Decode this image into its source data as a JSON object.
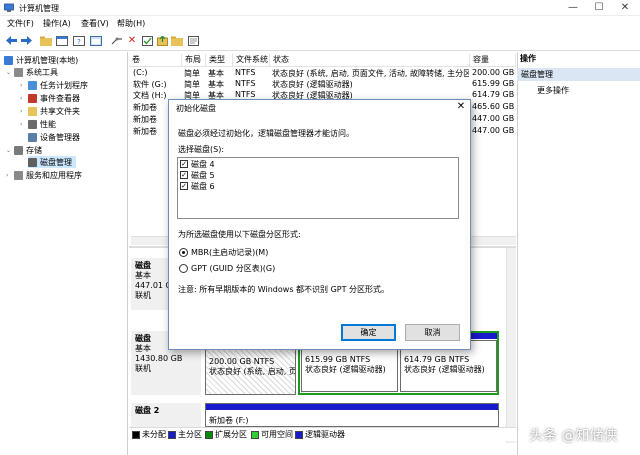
{
  "window": {
    "title": "计算机管理",
    "controls": [
      "—",
      "☐",
      "✕"
    ]
  },
  "menu": [
    "文件(F)",
    "操作(A)",
    "查看(V)",
    "帮助(H)"
  ],
  "toolbar": [
    "back-arrow-icon",
    "forward-arrow-icon",
    "folder-up-icon",
    "properties-icon",
    "help-icon",
    "console-icon",
    "connect-icon",
    "delete-icon",
    "check-icon",
    "export-icon",
    "folder-icon",
    "properties-sheet-icon"
  ],
  "tree": {
    "root": "计算机管理(本地)",
    "items": [
      {
        "label": "系统工具",
        "level": 1,
        "expanded": true,
        "selected": false
      },
      {
        "label": "任务计划程序",
        "level": 2,
        "expanded": false,
        "selected": false
      },
      {
        "label": "事件查看器",
        "level": 2,
        "expanded": false,
        "selected": false
      },
      {
        "label": "共享文件夹",
        "level": 2,
        "expanded": false,
        "selected": false
      },
      {
        "label": "性能",
        "level": 2,
        "expanded": false,
        "selected": false
      },
      {
        "label": "设备管理器",
        "level": 2,
        "expanded": false,
        "selected": false
      },
      {
        "label": "存储",
        "level": 1,
        "expanded": true,
        "selected": false
      },
      {
        "label": "磁盘管理",
        "level": 2,
        "expanded": false,
        "selected": true
      },
      {
        "label": "服务和应用程序",
        "level": 1,
        "expanded": false,
        "selected": false
      }
    ]
  },
  "volume_list": {
    "columns": [
      "卷",
      "布局",
      "类型",
      "文件系统",
      "状态",
      "容量"
    ],
    "rows": [
      {
        "vol": "(C:)",
        "layout": "简单",
        "type": "基本",
        "fs": "NTFS",
        "status": "状态良好 (系统, 启动, 页面文件, 活动, 故障转储, 主分区)",
        "size": "200.00 GB"
      },
      {
        "vol": "软件 (G:)",
        "layout": "简单",
        "type": "基本",
        "fs": "NTFS",
        "status": "状态良好 (逻辑驱动器)",
        "size": "615.99 GB"
      },
      {
        "vol": "文档 (H:)",
        "layout": "简单",
        "type": "基本",
        "fs": "NTFS",
        "status": "状态良好 (逻辑驱动器)",
        "size": "614.79 GB"
      },
      {
        "vol": "新加卷",
        "layout": "",
        "type": "",
        "fs": "",
        "status": "",
        "size": "465.60 GB"
      },
      {
        "vol": "新加卷",
        "layout": "",
        "type": "",
        "fs": "",
        "status": "",
        "size": "447.00 GB"
      },
      {
        "vol": "新加卷",
        "layout": "",
        "type": "",
        "fs": "",
        "status": "",
        "size": "447.00 GB"
      }
    ]
  },
  "actions": {
    "header": "操作",
    "group": "磁盘管理",
    "more": "更多操作"
  },
  "disks": [
    {
      "name": "磁盘",
      "type": "基本",
      "size": "447.01 GB",
      "state": "联机"
    },
    {
      "name": "磁盘",
      "type": "基本",
      "size": "1430.80 GB",
      "state": "联机",
      "partitions": [
        {
          "size": "200.00 GB NTFS",
          "status": "状态良好 (系统, 启动, 页"
        },
        {
          "size": "615.99 GB NTFS",
          "status": "状态良好 (逻辑驱动器)"
        },
        {
          "size": "614.79 GB NTFS",
          "status": "状态良好 (逻辑驱动器)"
        }
      ]
    },
    {
      "name": "磁盘 2",
      "partition_name": "新加卷 (F:)"
    }
  ],
  "legend": [
    {
      "label": "未分配",
      "color": "#000000"
    },
    {
      "label": "主分区",
      "color": "#1a1acd"
    },
    {
      "label": "扩展分区",
      "color": "#0a8a0a"
    },
    {
      "label": "可用空间",
      "color": "#33cc33"
    },
    {
      "label": "逻辑驱动器",
      "color": "#1a1acd"
    }
  ],
  "dialog": {
    "title": "初始化磁盘",
    "message": "磁盘必须经过初始化，逻辑磁盘管理器才能访问。",
    "select_label": "选择磁盘(S):",
    "disks": [
      {
        "label": "磁盘 4",
        "checked": true
      },
      {
        "label": "磁盘 5",
        "checked": true
      },
      {
        "label": "磁盘 6",
        "checked": true
      }
    ],
    "style_label": "为所选磁盘使用以下磁盘分区形式:",
    "options": [
      {
        "label": "MBR(主启动记录)(M)",
        "selected": true
      },
      {
        "label": "GPT (GUID 分区表)(G)",
        "selected": false
      }
    ],
    "note": "注意: 所有早期版本的 Windows 都不识别 GPT 分区形式。",
    "ok": "确定",
    "cancel": "取消"
  },
  "watermark": "头条 @知储侠"
}
